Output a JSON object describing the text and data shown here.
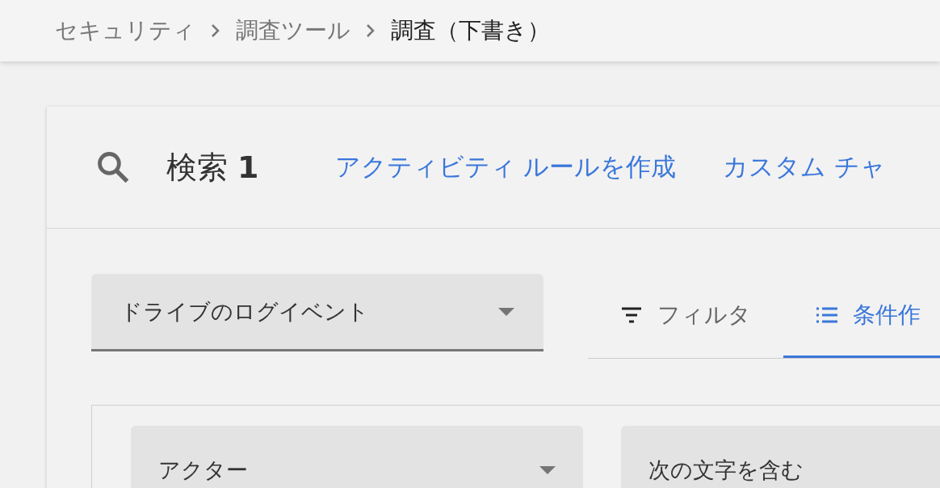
{
  "breadcrumb": [
    {
      "label": "セキュリティ",
      "current": false
    },
    {
      "label": "調査ツール",
      "current": false
    },
    {
      "label": "調査（下書き）",
      "current": true
    }
  ],
  "search": {
    "title": "検索",
    "number": "1",
    "links": [
      "アクティビティ ルールを作成",
      "カスタム チャ"
    ]
  },
  "source": {
    "value": "ドライブのログイベント"
  },
  "tabs": [
    {
      "label": "フィルタ",
      "kind": "filter",
      "selected": false
    },
    {
      "label": "条件作",
      "kind": "list",
      "selected": true
    }
  ],
  "conditions": [
    {
      "kind": "dropdown",
      "value": "アクター"
    },
    {
      "kind": "text",
      "value": "次の文字を含む"
    }
  ]
}
